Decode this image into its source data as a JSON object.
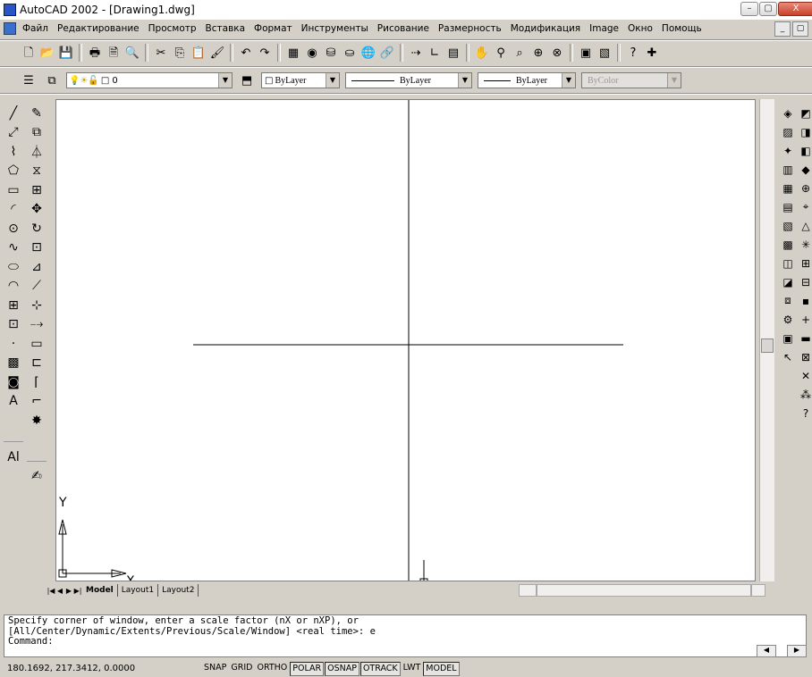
{
  "window": {
    "title": "AutoCAD 2002 - [Drawing1.dwg]",
    "min_label": "–",
    "max_label": "▢",
    "close_label": "X"
  },
  "doc_buttons": [
    "_",
    "▢"
  ],
  "menu": {
    "items": [
      "Файл",
      "Редактирование",
      "Просмотр",
      "Вставка",
      "Формат",
      "Инструменты",
      "Рисование",
      "Размерность",
      "Модификация",
      "Image",
      "Окно",
      "Помощь"
    ]
  },
  "standard_toolbar": {
    "icons": [
      {
        "name": "new-icon",
        "glyph": "🗋"
      },
      {
        "name": "open-icon",
        "glyph": "📂"
      },
      {
        "name": "save-icon",
        "glyph": "💾"
      },
      {
        "sep": true
      },
      {
        "name": "print-icon",
        "glyph": "🖶"
      },
      {
        "name": "print-preview-icon",
        "glyph": "🗎"
      },
      {
        "name": "find-icon",
        "glyph": "🔍"
      },
      {
        "sep": true
      },
      {
        "name": "cut-icon",
        "glyph": "✂"
      },
      {
        "name": "copy-icon",
        "glyph": "⎘"
      },
      {
        "name": "paste-icon",
        "glyph": "📋"
      },
      {
        "name": "match-properties-icon",
        "glyph": "🖌"
      },
      {
        "sep": true
      },
      {
        "name": "undo-icon",
        "glyph": "↶"
      },
      {
        "name": "redo-icon",
        "glyph": "↷"
      },
      {
        "sep": true
      },
      {
        "name": "design-center-icon",
        "glyph": "▦"
      },
      {
        "name": "properties-icon",
        "glyph": "◉"
      },
      {
        "name": "db-connect-icon",
        "glyph": "⛁"
      },
      {
        "name": "today-icon",
        "glyph": "⛀"
      },
      {
        "name": "publish-icon",
        "glyph": "🌐"
      },
      {
        "name": "hyperlink-icon",
        "glyph": "🔗"
      },
      {
        "sep": true
      },
      {
        "name": "distance-icon",
        "glyph": "⇢"
      },
      {
        "name": "ucs-icon",
        "glyph": "∟"
      },
      {
        "name": "named-views-icon",
        "glyph": "▤"
      },
      {
        "sep": true
      },
      {
        "name": "pan-icon",
        "glyph": "✋"
      },
      {
        "name": "zoom-realtime-icon",
        "glyph": "⚲"
      },
      {
        "name": "zoom-window-icon",
        "glyph": "⌕"
      },
      {
        "name": "zoom-previous-icon",
        "glyph": "⊕"
      },
      {
        "name": "zoom-extents-icon",
        "glyph": "⊗"
      },
      {
        "sep": true
      },
      {
        "name": "render-icon",
        "glyph": "▣"
      },
      {
        "name": "image-icon",
        "glyph": "▧"
      },
      {
        "sep": true
      },
      {
        "name": "help-icon",
        "glyph": "?"
      },
      {
        "name": "extra-icon",
        "glyph": "✚"
      }
    ]
  },
  "properties_toolbar": {
    "layer_value": "0",
    "color_value": "ByLayer",
    "linetype_value": "ByLayer",
    "lineweight_value": "ByLayer",
    "plotstyle_value": "ByColor"
  },
  "draw_tools": [
    {
      "name": "line-tool-icon",
      "glyph": "╱"
    },
    {
      "name": "construction-line-icon",
      "glyph": "⤢"
    },
    {
      "name": "polyline-icon",
      "glyph": "⌇"
    },
    {
      "name": "polygon-icon",
      "glyph": "⬠"
    },
    {
      "name": "rectangle-icon",
      "glyph": "▭"
    },
    {
      "name": "arc-icon",
      "glyph": "◜"
    },
    {
      "name": "circle-icon",
      "glyph": "⊙"
    },
    {
      "name": "spline-icon",
      "glyph": "∿"
    },
    {
      "name": "ellipse-icon",
      "glyph": "⬭"
    },
    {
      "name": "ellipse-arc-icon",
      "glyph": "◠"
    },
    {
      "name": "insert-block-icon",
      "glyph": "⊞"
    },
    {
      "name": "make-block-icon",
      "glyph": "⊡"
    },
    {
      "name": "point-icon",
      "glyph": "·"
    },
    {
      "name": "hatch-icon",
      "glyph": "▩"
    },
    {
      "name": "region-icon",
      "glyph": "◙"
    },
    {
      "name": "multiline-text-icon",
      "glyph": "A"
    },
    {
      "sep": true
    },
    {
      "name": "text-style-icon",
      "glyph": "Al"
    }
  ],
  "modify_tools": [
    {
      "name": "erase-icon",
      "glyph": "✎"
    },
    {
      "name": "copy-object-icon",
      "glyph": "⧉"
    },
    {
      "name": "mirror-icon",
      "glyph": "⏃"
    },
    {
      "name": "offset-icon",
      "glyph": "⧖"
    },
    {
      "name": "array-icon",
      "glyph": "⊞"
    },
    {
      "name": "move-icon",
      "glyph": "✥"
    },
    {
      "name": "rotate-icon",
      "glyph": "↻"
    },
    {
      "name": "scale-icon",
      "glyph": "⊡"
    },
    {
      "name": "stretch-icon",
      "glyph": "⊿"
    },
    {
      "name": "lengthen-icon",
      "glyph": "⟋"
    },
    {
      "name": "trim-icon",
      "glyph": "⊹"
    },
    {
      "name": "extend-icon",
      "glyph": "⤍"
    },
    {
      "name": "break-icon",
      "glyph": "▭"
    },
    {
      "name": "break-at-point-icon",
      "glyph": "⊏"
    },
    {
      "name": "chamfer-icon",
      "glyph": "⌈"
    },
    {
      "name": "fillet-icon",
      "glyph": "⌐"
    },
    {
      "name": "explode-icon",
      "glyph": "✸"
    },
    {
      "sep": true
    },
    {
      "name": "edit-text-icon",
      "glyph": "✍"
    }
  ],
  "right_tools_a": [
    {
      "name": "render-tool-icon",
      "glyph": "◈"
    },
    {
      "name": "scene-icon",
      "glyph": "▨"
    },
    {
      "name": "light-icon",
      "glyph": "✦"
    },
    {
      "name": "materials-icon",
      "glyph": "▥"
    },
    {
      "name": "materials-library-icon",
      "glyph": "▦"
    },
    {
      "name": "mapping-icon",
      "glyph": "▤"
    },
    {
      "name": "background-icon",
      "glyph": "▧"
    },
    {
      "name": "fog-icon",
      "glyph": "▩"
    },
    {
      "name": "landscape-new-icon",
      "glyph": "◫"
    },
    {
      "name": "landscape-edit-icon",
      "glyph": "◪"
    },
    {
      "name": "landscape-library-icon",
      "glyph": "⧈"
    },
    {
      "name": "preferences-icon",
      "glyph": "⚙"
    },
    {
      "name": "statistics-icon",
      "glyph": "▣"
    },
    {
      "name": "pointer-icon",
      "glyph": "↖"
    }
  ],
  "right_tools_b": [
    {
      "name": "ucs-world-icon",
      "glyph": "◩"
    },
    {
      "name": "ucs-object-icon",
      "glyph": "◨"
    },
    {
      "name": "ucs-face-icon",
      "glyph": "◧"
    },
    {
      "name": "ucs-view-icon",
      "glyph": "◆"
    },
    {
      "name": "ucs-origin-icon",
      "glyph": "⊕"
    },
    {
      "name": "ucs-zaxis-icon",
      "glyph": "⌖"
    },
    {
      "name": "ucs-3point-icon",
      "glyph": "△"
    },
    {
      "name": "ucs-x-icon",
      "glyph": "✳"
    },
    {
      "name": "ucs-y-icon",
      "glyph": "⊞"
    },
    {
      "name": "ucs-z-icon",
      "glyph": "⊟"
    },
    {
      "name": "ucs-apply-icon",
      "glyph": "▪"
    },
    {
      "name": "ucs-named-icon",
      "glyph": "+"
    },
    {
      "name": "ucs-preset-icon",
      "glyph": "▬"
    },
    {
      "name": "ucs-previous-icon",
      "glyph": "⊠"
    },
    {
      "name": "ucs-extra1-icon",
      "glyph": "✕"
    },
    {
      "name": "ucs-extra2-icon",
      "glyph": "⁂"
    },
    {
      "name": "ucs-extra3-icon",
      "glyph": "?"
    }
  ],
  "canvas": {
    "ucs_y_label": "Y",
    "ucs_x_label": "X"
  },
  "tabs": {
    "nav": [
      "|◀",
      "◀",
      "▶",
      "▶|"
    ],
    "items": [
      "Model",
      "Layout1",
      "Layout2"
    ],
    "active_index": 0
  },
  "command": {
    "lines": [
      "Specify corner of window, enter a scale factor (nX or nXP), or",
      "[All/Center/Dynamic/Extents/Previous/Scale/Window] <real time>: e",
      "Command:"
    ]
  },
  "status": {
    "coords": "180.1692, 217.3412, 0.0000",
    "toggles": [
      {
        "label": "SNAP",
        "on": false
      },
      {
        "label": "GRID",
        "on": false
      },
      {
        "label": "ORTHO",
        "on": false
      },
      {
        "label": "POLAR",
        "on": true
      },
      {
        "label": "OSNAP",
        "on": true
      },
      {
        "label": "OTRACK",
        "on": true
      },
      {
        "label": "LWT",
        "on": false
      },
      {
        "label": "MODEL",
        "on": true
      }
    ]
  }
}
